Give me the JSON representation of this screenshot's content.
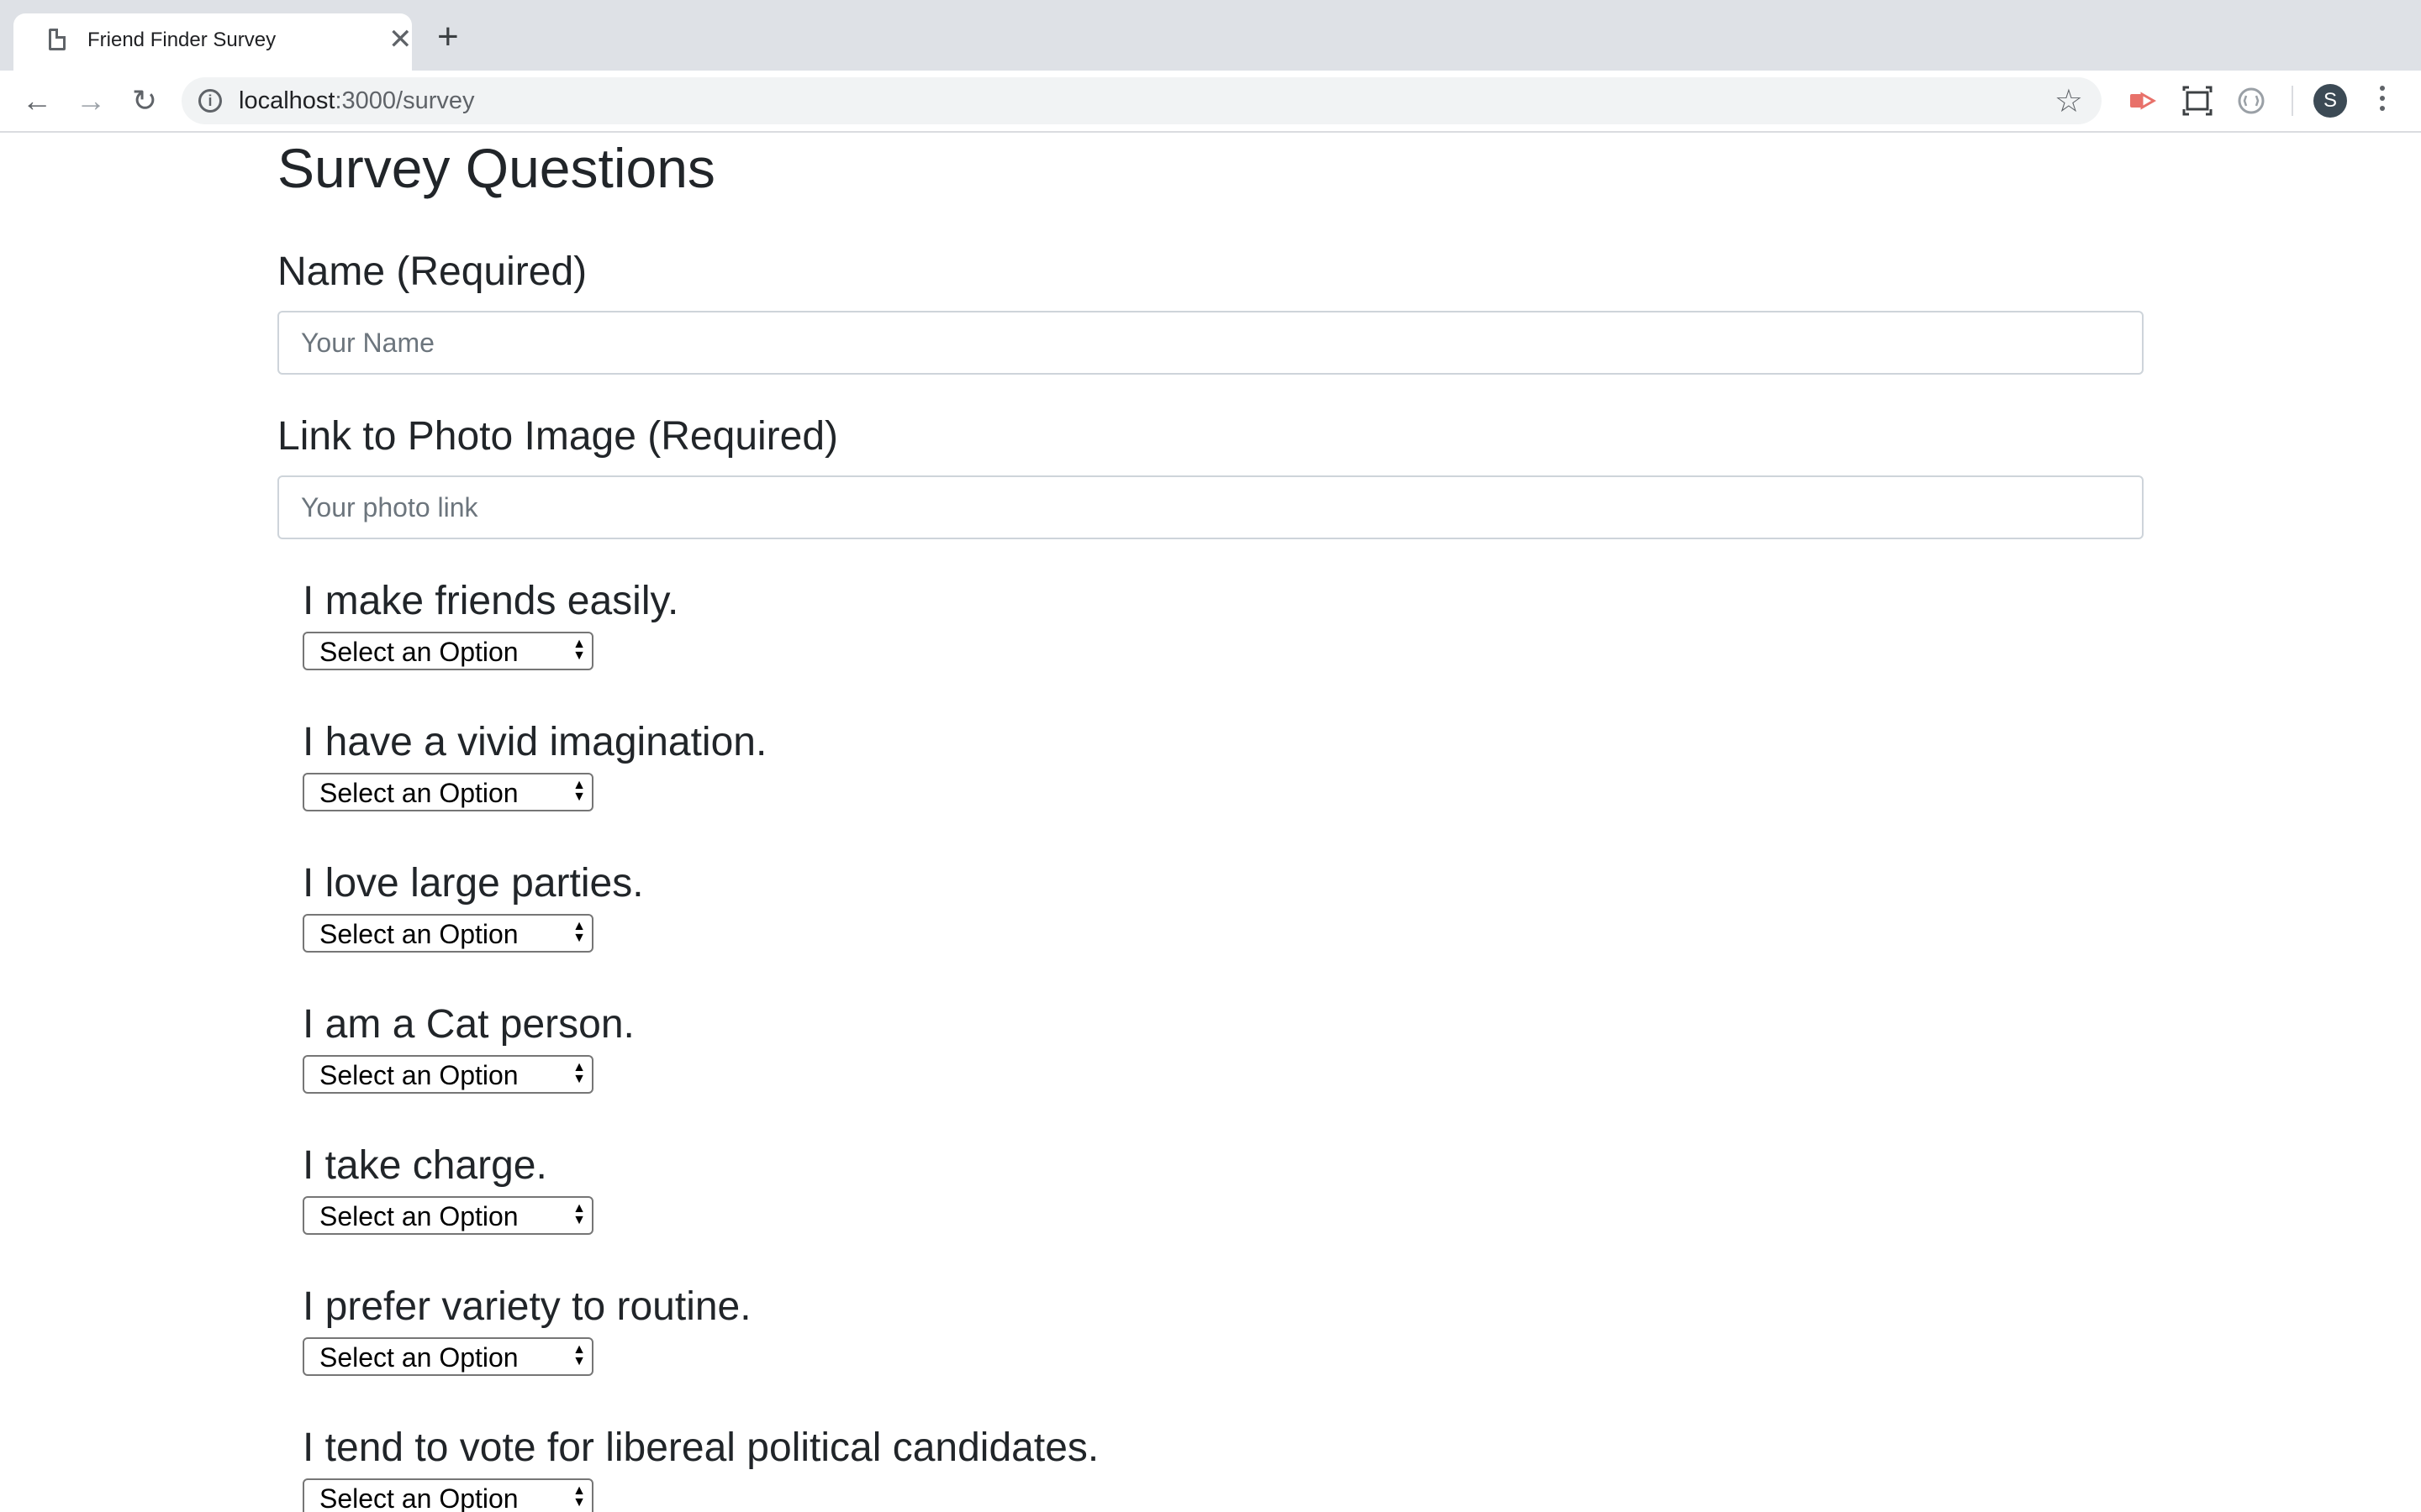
{
  "browser": {
    "tab_title": "Friend Finder Survey",
    "tab_close": "✕",
    "new_tab": "+",
    "url_host": "localhost",
    "url_path": ":3000/survey",
    "back_icon": "←",
    "forward_icon": "→",
    "reload_icon": "↻",
    "star_icon": "☆",
    "profile_initial": "S"
  },
  "survey": {
    "title": "Survey Questions",
    "name_label": "Name (Required)",
    "name_placeholder": "Your Name",
    "photo_label": "Link to Photo Image (Required)",
    "photo_placeholder": "Your photo link",
    "select_default": "Select an Option",
    "questions": [
      "I make friends easily.",
      "I have a vivid imagination.",
      "I love large parties.",
      "I am a Cat person.",
      "I take charge.",
      "I prefer variety to routine.",
      "I tend to vote for libereal political candidates."
    ]
  },
  "icons": {
    "tab": "page-icon",
    "extensions": [
      "cast-icon",
      "screenshot-icon",
      "extension-icon"
    ]
  }
}
